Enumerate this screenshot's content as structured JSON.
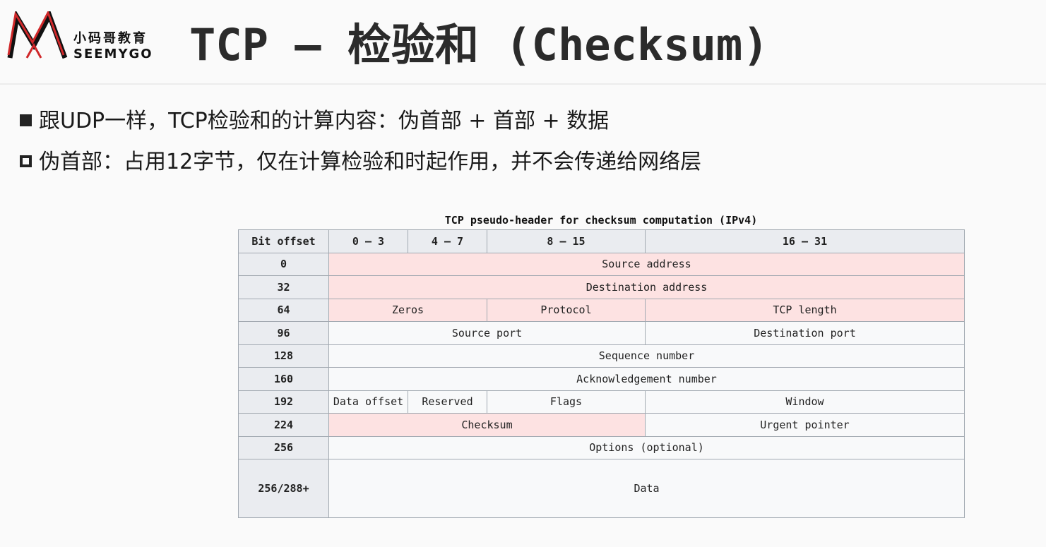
{
  "logo": {
    "cn": "小码哥教育",
    "en": "SEEMYGO"
  },
  "title": "TCP – 检验和 (Checksum)",
  "bullets": [
    "跟UDP一样，TCP检验和的计算内容：伪首部 + 首部 + 数据",
    "伪首部：占用12字节，仅在计算检验和时起作用，并不会传递给网络层"
  ],
  "table": {
    "caption": "TCP pseudo-header for checksum computation (IPv4)",
    "head": [
      "Bit offset",
      "0 – 3",
      "4 – 7",
      "8 – 15",
      "16 – 31"
    ],
    "offsets": [
      "0",
      "32",
      "64",
      "96",
      "128",
      "160",
      "192",
      "224",
      "256",
      "256/288+"
    ],
    "cells": {
      "source_address": "Source address",
      "destination_address": "Destination address",
      "zeros": "Zeros",
      "protocol": "Protocol",
      "tcp_length": "TCP length",
      "source_port": "Source port",
      "destination_port": "Destination port",
      "sequence_number": "Sequence number",
      "acknowledgement_number": "Acknowledgement number",
      "data_offset": "Data offset",
      "reserved": "Reserved",
      "flags": "Flags",
      "window": "Window",
      "checksum": "Checksum",
      "urgent_pointer": "Urgent pointer",
      "options": "Options (optional)",
      "data": "Data"
    }
  },
  "colors": {
    "pseudo_header_fill": "#fde2e2",
    "header_fill": "#eaecf0",
    "cell_fill": "#f8f9fa",
    "logo_red": "#d0282a"
  }
}
